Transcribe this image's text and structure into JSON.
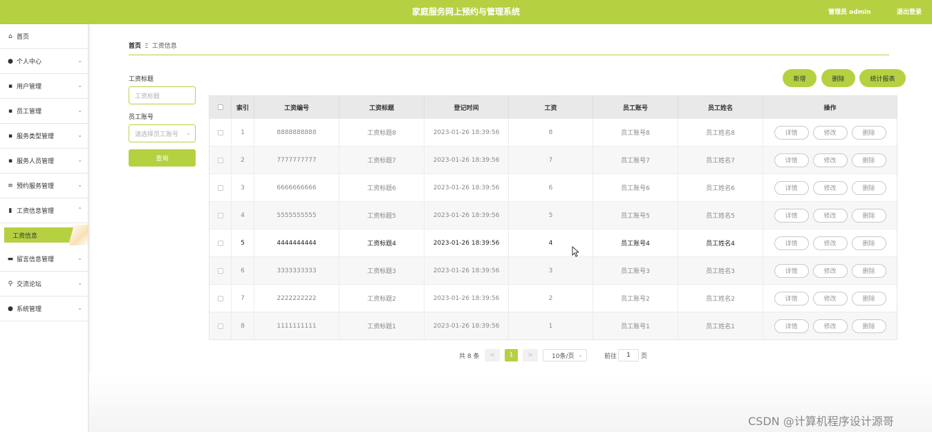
{
  "header": {
    "title": "家庭服务网上预约与管理系统",
    "admin": "管理员 admin",
    "logout": "退出登录",
    "color": "#b5d142"
  },
  "sidebar": {
    "items": [
      {
        "label": "首页",
        "icon": "home-icon"
      },
      {
        "label": "个人中心",
        "icon": "user-icon"
      },
      {
        "label": "用户管理",
        "icon": "grid-icon"
      },
      {
        "label": "员工管理",
        "icon": "grid-icon"
      },
      {
        "label": "服务类型管理",
        "icon": "grid-icon"
      },
      {
        "label": "服务人员管理",
        "icon": "grid-icon"
      },
      {
        "label": "预约服务管理",
        "icon": "list-icon"
      },
      {
        "label": "工资信息管理",
        "icon": "clipboard-icon"
      },
      {
        "label": "留言信息管理",
        "icon": "message-icon"
      },
      {
        "label": "交流论坛",
        "icon": "person-icon"
      },
      {
        "label": "系统管理",
        "icon": "user-icon"
      }
    ],
    "active_sub": "工资信息"
  },
  "breadcrumb": {
    "home": "首页",
    "sep": "Ξ",
    "current": "工资信息"
  },
  "search": {
    "title_label": "工资标题",
    "title_placeholder": "工资标题",
    "account_label": "员工账号",
    "account_placeholder": "请选择员工账号",
    "query_button": "查询"
  },
  "actions": {
    "add": "新增",
    "delete": "删除",
    "report": "统计报表"
  },
  "table": {
    "headers": [
      "索引",
      "工资编号",
      "工资标题",
      "登记时间",
      "工资",
      "员工账号",
      "员工姓名",
      "操作"
    ],
    "rows": [
      {
        "index": "1",
        "code": "8888888888",
        "title": "工资标题8",
        "time": "2023-01-26 18:39:56",
        "salary": "8",
        "account": "员工账号8",
        "name": "员工姓名8"
      },
      {
        "index": "2",
        "code": "7777777777",
        "title": "工资标题7",
        "time": "2023-01-26 18:39:56",
        "salary": "7",
        "account": "员工账号7",
        "name": "员工姓名7"
      },
      {
        "index": "3",
        "code": "6666666666",
        "title": "工资标题6",
        "time": "2023-01-26 18:39:56",
        "salary": "6",
        "account": "员工账号6",
        "name": "员工姓名6"
      },
      {
        "index": "4",
        "code": "5555555555",
        "title": "工资标题5",
        "time": "2023-01-26 18:39:56",
        "salary": "5",
        "account": "员工账号5",
        "name": "员工姓名5"
      },
      {
        "index": "5",
        "code": "4444444444",
        "title": "工资标题4",
        "time": "2023-01-26 18:39:56",
        "salary": "4",
        "account": "员工账号4",
        "name": "员工姓名4"
      },
      {
        "index": "6",
        "code": "3333333333",
        "title": "工资标题3",
        "time": "2023-01-26 18:39:56",
        "salary": "3",
        "account": "员工账号3",
        "name": "员工姓名3"
      },
      {
        "index": "7",
        "code": "2222222222",
        "title": "工资标题2",
        "time": "2023-01-26 18:39:56",
        "salary": "2",
        "account": "员工账号2",
        "name": "员工姓名2"
      },
      {
        "index": "8",
        "code": "1111111111",
        "title": "工资标题1",
        "time": "2023-01-26 18:39:56",
        "salary": "1",
        "account": "员工账号1",
        "name": "员工姓名1"
      }
    ],
    "ops": {
      "detail": "详情",
      "edit": "修改",
      "delete": "删除"
    }
  },
  "pagination": {
    "total": "共 8 条",
    "prev": "<",
    "page": "1",
    "next": ">",
    "page_size": "10条/页",
    "goto": "前往",
    "goto_value": "1",
    "page_unit": "页"
  },
  "watermark": "CSDN @计算机程序设计源哥"
}
